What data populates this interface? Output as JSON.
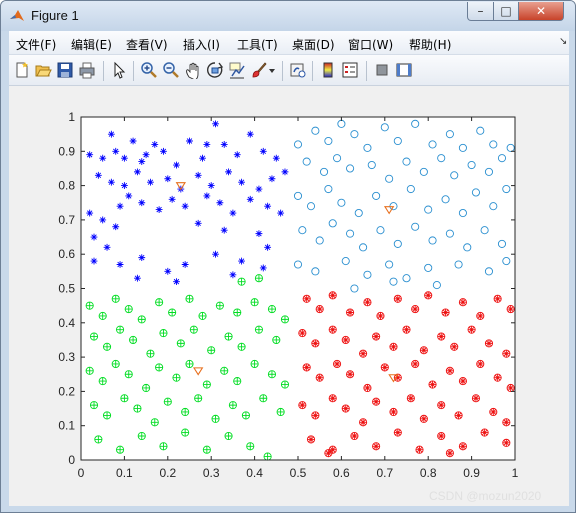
{
  "window": {
    "title": "Figure 1",
    "min_glyph": "–",
    "max_glyph": "□",
    "close_glyph": "✕"
  },
  "menu": {
    "items": [
      "文件(F)",
      "编辑(E)",
      "查看(V)",
      "插入(I)",
      "工具(T)",
      "桌面(D)",
      "窗口(W)",
      "帮助(H)"
    ],
    "overflow_glyph": "↘"
  },
  "toolbar": {
    "icons": [
      "new-figure-icon",
      "open-file-icon",
      "save-icon",
      "print-icon",
      "pointer-icon",
      "zoom-in-icon",
      "zoom-out-icon",
      "pan-icon",
      "rotate-3d-icon",
      "data-cursor-icon",
      "brush-icon",
      "brush-dropdown-icon",
      "link-plot-icon",
      "colorbar-icon",
      "legend-icon",
      "hide-plot-tools-icon",
      "show-plot-tools-icon"
    ]
  },
  "watermark": "CSDN @mozun2020",
  "chart_data": {
    "type": "scatter",
    "title": "",
    "xlabel": "",
    "ylabel": "",
    "xlim": [
      0,
      1
    ],
    "ylim": [
      0,
      1
    ],
    "xticks": [
      "0",
      "0.1",
      "0.2",
      "0.3",
      "0.4",
      "0.5",
      "0.6",
      "0.7",
      "0.8",
      "0.9",
      "1"
    ],
    "yticks": [
      "0",
      "0.1",
      "0.2",
      "0.3",
      "0.4",
      "0.5",
      "0.6",
      "0.7",
      "0.8",
      "0.9",
      "1"
    ],
    "grid": false,
    "legend": "none",
    "colors": {
      "blue": "#0000ff",
      "cyan": "#2a8fd0",
      "green": "#00dd22",
      "red": "#ee1111",
      "centroid": "#e8701f"
    },
    "series": [
      {
        "marker": "asterisk",
        "color": "blue",
        "points": [
          [
            0.02,
            0.89
          ],
          [
            0.05,
            0.88
          ],
          [
            0.07,
            0.95
          ],
          [
            0.08,
            0.9
          ],
          [
            0.1,
            0.88
          ],
          [
            0.12,
            0.93
          ],
          [
            0.14,
            0.87
          ],
          [
            0.17,
            0.92
          ],
          [
            0.19,
            0.9
          ],
          [
            0.22,
            0.86
          ],
          [
            0.25,
            0.93
          ],
          [
            0.28,
            0.88
          ],
          [
            0.31,
            0.98
          ],
          [
            0.33,
            0.92
          ],
          [
            0.36,
            0.89
          ],
          [
            0.39,
            0.95
          ],
          [
            0.42,
            0.9
          ],
          [
            0.45,
            0.88
          ],
          [
            0.47,
            0.84
          ],
          [
            0.04,
            0.83
          ],
          [
            0.07,
            0.81
          ],
          [
            0.1,
            0.8
          ],
          [
            0.13,
            0.84
          ],
          [
            0.16,
            0.81
          ],
          [
            0.2,
            0.82
          ],
          [
            0.23,
            0.79
          ],
          [
            0.27,
            0.83
          ],
          [
            0.3,
            0.8
          ],
          [
            0.34,
            0.84
          ],
          [
            0.37,
            0.81
          ],
          [
            0.41,
            0.79
          ],
          [
            0.44,
            0.82
          ],
          [
            0.02,
            0.72
          ],
          [
            0.05,
            0.7
          ],
          [
            0.09,
            0.74
          ],
          [
            0.11,
            0.77
          ],
          [
            0.14,
            0.75
          ],
          [
            0.18,
            0.73
          ],
          [
            0.21,
            0.76
          ],
          [
            0.24,
            0.74
          ],
          [
            0.29,
            0.77
          ],
          [
            0.32,
            0.75
          ],
          [
            0.35,
            0.72
          ],
          [
            0.39,
            0.76
          ],
          [
            0.43,
            0.74
          ],
          [
            0.46,
            0.72
          ],
          [
            0.03,
            0.65
          ],
          [
            0.06,
            0.62
          ],
          [
            0.08,
            0.68
          ],
          [
            0.27,
            0.69
          ],
          [
            0.33,
            0.67
          ],
          [
            0.41,
            0.66
          ],
          [
            0.43,
            0.62
          ],
          [
            0.03,
            0.58
          ],
          [
            0.09,
            0.57
          ],
          [
            0.14,
            0.59
          ],
          [
            0.2,
            0.55
          ],
          [
            0.24,
            0.57
          ],
          [
            0.31,
            0.6
          ],
          [
            0.37,
            0.58
          ],
          [
            0.42,
            0.56
          ],
          [
            0.13,
            0.53
          ],
          [
            0.22,
            0.52
          ],
          [
            0.35,
            0.54
          ],
          [
            0.15,
            0.89
          ],
          [
            0.29,
            0.92
          ]
        ]
      },
      {
        "marker": "circle",
        "color": "cyan",
        "points": [
          [
            0.5,
            0.92
          ],
          [
            0.54,
            0.96
          ],
          [
            0.57,
            0.93
          ],
          [
            0.6,
            0.98
          ],
          [
            0.63,
            0.95
          ],
          [
            0.66,
            0.91
          ],
          [
            0.7,
            0.97
          ],
          [
            0.73,
            0.93
          ],
          [
            0.77,
            0.98
          ],
          [
            0.81,
            0.92
          ],
          [
            0.85,
            0.95
          ],
          [
            0.88,
            0.91
          ],
          [
            0.92,
            0.96
          ],
          [
            0.95,
            0.92
          ],
          [
            0.99,
            0.91
          ],
          [
            0.52,
            0.87
          ],
          [
            0.56,
            0.84
          ],
          [
            0.59,
            0.88
          ],
          [
            0.62,
            0.85
          ],
          [
            0.67,
            0.86
          ],
          [
            0.71,
            0.82
          ],
          [
            0.75,
            0.87
          ],
          [
            0.79,
            0.84
          ],
          [
            0.83,
            0.88
          ],
          [
            0.86,
            0.83
          ],
          [
            0.9,
            0.86
          ],
          [
            0.94,
            0.84
          ],
          [
            0.97,
            0.88
          ],
          [
            0.5,
            0.77
          ],
          [
            0.53,
            0.74
          ],
          [
            0.57,
            0.79
          ],
          [
            0.6,
            0.75
          ],
          [
            0.64,
            0.72
          ],
          [
            0.68,
            0.77
          ],
          [
            0.72,
            0.74
          ],
          [
            0.76,
            0.79
          ],
          [
            0.8,
            0.73
          ],
          [
            0.84,
            0.76
          ],
          [
            0.88,
            0.72
          ],
          [
            0.91,
            0.78
          ],
          [
            0.95,
            0.74
          ],
          [
            0.98,
            0.79
          ],
          [
            0.51,
            0.67
          ],
          [
            0.55,
            0.64
          ],
          [
            0.58,
            0.69
          ],
          [
            0.62,
            0.66
          ],
          [
            0.65,
            0.62
          ],
          [
            0.69,
            0.67
          ],
          [
            0.73,
            0.63
          ],
          [
            0.77,
            0.68
          ],
          [
            0.81,
            0.64
          ],
          [
            0.85,
            0.66
          ],
          [
            0.89,
            0.62
          ],
          [
            0.93,
            0.67
          ],
          [
            0.97,
            0.63
          ],
          [
            0.5,
            0.57
          ],
          [
            0.54,
            0.55
          ],
          [
            0.61,
            0.58
          ],
          [
            0.66,
            0.54
          ],
          [
            0.71,
            0.57
          ],
          [
            0.75,
            0.53
          ],
          [
            0.8,
            0.56
          ],
          [
            0.87,
            0.57
          ],
          [
            0.94,
            0.55
          ],
          [
            0.98,
            0.58
          ],
          [
            0.63,
            0.5
          ],
          [
            0.72,
            0.52
          ],
          [
            0.82,
            0.51
          ]
        ]
      },
      {
        "marker": "circle-plus",
        "color": "green",
        "points": [
          [
            0.02,
            0.45
          ],
          [
            0.05,
            0.42
          ],
          [
            0.08,
            0.47
          ],
          [
            0.11,
            0.44
          ],
          [
            0.14,
            0.41
          ],
          [
            0.18,
            0.46
          ],
          [
            0.21,
            0.43
          ],
          [
            0.25,
            0.47
          ],
          [
            0.28,
            0.42
          ],
          [
            0.32,
            0.45
          ],
          [
            0.36,
            0.43
          ],
          [
            0.4,
            0.46
          ],
          [
            0.44,
            0.44
          ],
          [
            0.47,
            0.41
          ],
          [
            0.03,
            0.36
          ],
          [
            0.06,
            0.33
          ],
          [
            0.09,
            0.38
          ],
          [
            0.12,
            0.35
          ],
          [
            0.16,
            0.31
          ],
          [
            0.19,
            0.37
          ],
          [
            0.23,
            0.34
          ],
          [
            0.26,
            0.38
          ],
          [
            0.3,
            0.32
          ],
          [
            0.34,
            0.36
          ],
          [
            0.37,
            0.33
          ],
          [
            0.41,
            0.38
          ],
          [
            0.45,
            0.35
          ],
          [
            0.02,
            0.26
          ],
          [
            0.05,
            0.23
          ],
          [
            0.08,
            0.28
          ],
          [
            0.11,
            0.25
          ],
          [
            0.15,
            0.21
          ],
          [
            0.18,
            0.27
          ],
          [
            0.22,
            0.24
          ],
          [
            0.25,
            0.28
          ],
          [
            0.29,
            0.22
          ],
          [
            0.33,
            0.26
          ],
          [
            0.36,
            0.23
          ],
          [
            0.4,
            0.28
          ],
          [
            0.44,
            0.25
          ],
          [
            0.47,
            0.22
          ],
          [
            0.03,
            0.16
          ],
          [
            0.06,
            0.13
          ],
          [
            0.1,
            0.18
          ],
          [
            0.13,
            0.15
          ],
          [
            0.17,
            0.11
          ],
          [
            0.2,
            0.17
          ],
          [
            0.24,
            0.14
          ],
          [
            0.27,
            0.18
          ],
          [
            0.31,
            0.12
          ],
          [
            0.35,
            0.16
          ],
          [
            0.38,
            0.13
          ],
          [
            0.42,
            0.18
          ],
          [
            0.46,
            0.14
          ],
          [
            0.04,
            0.06
          ],
          [
            0.09,
            0.03
          ],
          [
            0.14,
            0.07
          ],
          [
            0.19,
            0.04
          ],
          [
            0.24,
            0.08
          ],
          [
            0.29,
            0.03
          ],
          [
            0.34,
            0.07
          ],
          [
            0.39,
            0.04
          ],
          [
            0.43,
            0.01
          ],
          [
            0.37,
            0.52
          ],
          [
            0.41,
            0.53
          ]
        ]
      },
      {
        "marker": "circle-asterisk",
        "color": "red",
        "points": [
          [
            0.52,
            0.47
          ],
          [
            0.55,
            0.44
          ],
          [
            0.58,
            0.48
          ],
          [
            0.62,
            0.43
          ],
          [
            0.66,
            0.46
          ],
          [
            0.69,
            0.42
          ],
          [
            0.73,
            0.47
          ],
          [
            0.77,
            0.44
          ],
          [
            0.8,
            0.48
          ],
          [
            0.84,
            0.43
          ],
          [
            0.88,
            0.46
          ],
          [
            0.92,
            0.42
          ],
          [
            0.96,
            0.47
          ],
          [
            0.99,
            0.44
          ],
          [
            0.51,
            0.37
          ],
          [
            0.54,
            0.34
          ],
          [
            0.58,
            0.38
          ],
          [
            0.61,
            0.35
          ],
          [
            0.65,
            0.31
          ],
          [
            0.68,
            0.36
          ],
          [
            0.72,
            0.33
          ],
          [
            0.75,
            0.38
          ],
          [
            0.79,
            0.32
          ],
          [
            0.83,
            0.36
          ],
          [
            0.86,
            0.33
          ],
          [
            0.9,
            0.38
          ],
          [
            0.94,
            0.34
          ],
          [
            0.98,
            0.31
          ],
          [
            0.52,
            0.27
          ],
          [
            0.55,
            0.24
          ],
          [
            0.59,
            0.28
          ],
          [
            0.62,
            0.25
          ],
          [
            0.66,
            0.21
          ],
          [
            0.7,
            0.27
          ],
          [
            0.73,
            0.24
          ],
          [
            0.77,
            0.28
          ],
          [
            0.81,
            0.22
          ],
          [
            0.85,
            0.26
          ],
          [
            0.88,
            0.23
          ],
          [
            0.92,
            0.28
          ],
          [
            0.96,
            0.24
          ],
          [
            0.99,
            0.21
          ],
          [
            0.51,
            0.16
          ],
          [
            0.54,
            0.13
          ],
          [
            0.58,
            0.18
          ],
          [
            0.61,
            0.15
          ],
          [
            0.65,
            0.11
          ],
          [
            0.68,
            0.17
          ],
          [
            0.72,
            0.14
          ],
          [
            0.76,
            0.18
          ],
          [
            0.79,
            0.12
          ],
          [
            0.83,
            0.16
          ],
          [
            0.87,
            0.13
          ],
          [
            0.91,
            0.18
          ],
          [
            0.95,
            0.14
          ],
          [
            0.98,
            0.11
          ],
          [
            0.53,
            0.06
          ],
          [
            0.58,
            0.03
          ],
          [
            0.63,
            0.07
          ],
          [
            0.68,
            0.04
          ],
          [
            0.73,
            0.08
          ],
          [
            0.78,
            0.03
          ],
          [
            0.83,
            0.07
          ],
          [
            0.88,
            0.04
          ],
          [
            0.93,
            0.08
          ],
          [
            0.98,
            0.05
          ],
          [
            0.57,
            0.02
          ],
          [
            0.85,
            0.02
          ]
        ]
      },
      {
        "marker": "triangle-down",
        "color": "centroid",
        "points": [
          [
            0.23,
            0.8
          ],
          [
            0.71,
            0.73
          ],
          [
            0.27,
            0.26
          ],
          [
            0.72,
            0.24
          ]
        ]
      }
    ]
  }
}
